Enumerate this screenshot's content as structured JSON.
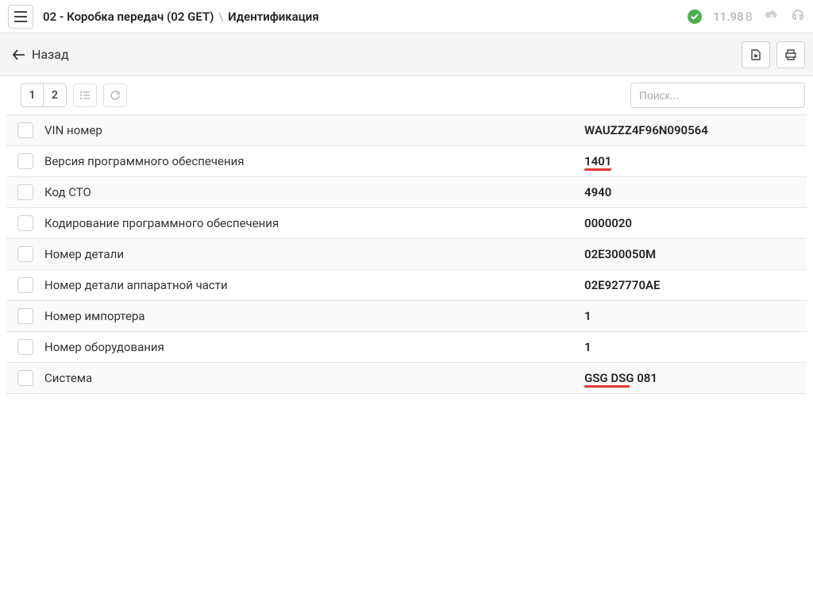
{
  "header": {
    "breadcrumb_main": "02 - Коробка передач (02 GET)",
    "breadcrumb_sep": "\\",
    "breadcrumb_second": "Идентификация",
    "voltage_value": "11.98",
    "voltage_unit": "В"
  },
  "toolbar": {
    "back_label": "Назад"
  },
  "tabs": {
    "tab1": "1",
    "tab2": "2"
  },
  "search": {
    "placeholder": "Поиск..."
  },
  "rows": [
    {
      "label": "VIN номер",
      "value": "WAUZZZ4F96N090564",
      "highlight": "none"
    },
    {
      "label": "Версия программного обеспечения",
      "value": "1401",
      "highlight": "full"
    },
    {
      "label": "Код СТО",
      "value": "4940",
      "highlight": "none"
    },
    {
      "label": "Кодирование программного обеспечения",
      "value": "0000020",
      "highlight": "none"
    },
    {
      "label": "Номер детали",
      "value": "02E300050M",
      "highlight": "none"
    },
    {
      "label": "Номер детали аппаратной части",
      "value": "02E927770AE",
      "highlight": "none"
    },
    {
      "label": "Номер импортера",
      "value": "1",
      "highlight": "none"
    },
    {
      "label": "Номер оборудования",
      "value": "1",
      "highlight": "none"
    },
    {
      "label": "Система",
      "value": "GSG DSG 081",
      "highlight": "partial"
    }
  ]
}
